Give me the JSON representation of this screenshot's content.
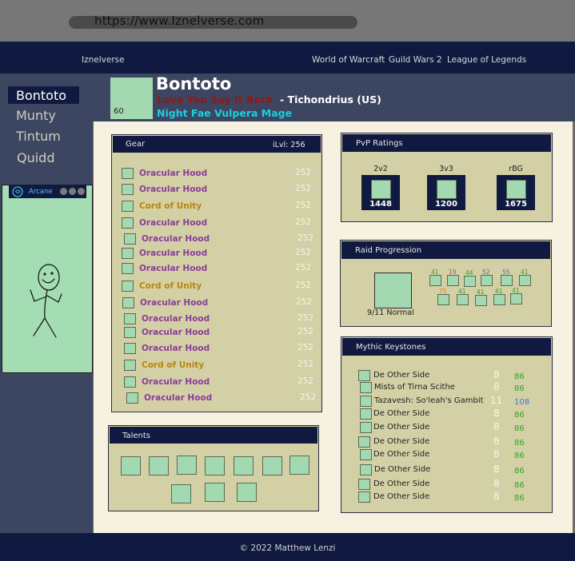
{
  "browser": {
    "url": "https://www.Iznelverse.com"
  },
  "nav": {
    "brand": "Iznelverse",
    "links": [
      "World of Warcraft",
      "Guild Wars 2",
      "League of Legends"
    ]
  },
  "sidebar": {
    "characters": [
      "Bontoto",
      "Munty",
      "Tintum",
      "Quidd"
    ],
    "spec": {
      "label": "Arcane"
    }
  },
  "character": {
    "name": "Bontoto",
    "guild": "Love You Say It Back",
    "realm": "- Tichondrius (US)",
    "race_class": "Night Fae Vulpera Mage",
    "portrait_level": "60"
  },
  "gear": {
    "title": "Gear",
    "ilvl": "iLvl: 256",
    "items": [
      {
        "name": "Oracular Hood",
        "lvl": "252",
        "color": "#8a3d9a"
      },
      {
        "name": "Oracular Hood",
        "lvl": "252",
        "color": "#8a3d9a"
      },
      {
        "name": "Cord of Unity",
        "lvl": "252",
        "color": "#b8860b"
      },
      {
        "name": "Oracular Hood",
        "lvl": "252",
        "color": "#8a3d9a"
      },
      {
        "name": "Oracular Hood",
        "lvl": "252",
        "color": "#8a3d9a"
      },
      {
        "name": "Oracular Hood",
        "lvl": "252",
        "color": "#8a3d9a"
      },
      {
        "name": "Oracular Hood",
        "lvl": "252",
        "color": "#8a3d9a"
      },
      {
        "name": "Cord of Unity",
        "lvl": "252",
        "color": "#b8860b"
      },
      {
        "name": "Oracular Hood",
        "lvl": "252",
        "color": "#8a3d9a"
      },
      {
        "name": "Oracular Hood",
        "lvl": "252",
        "color": "#8a3d9a"
      },
      {
        "name": "Oracular Hood",
        "lvl": "252",
        "color": "#8a3d9a"
      },
      {
        "name": "Oracular Hood",
        "lvl": "252",
        "color": "#8a3d9a"
      },
      {
        "name": "Cord of Unity",
        "lvl": "252",
        "color": "#b8860b"
      },
      {
        "name": "Oracular Hood",
        "lvl": "252",
        "color": "#8a3d9a"
      },
      {
        "name": "Oracular Hood",
        "lvl": "252",
        "color": "#8a3d9a"
      }
    ]
  },
  "talents": {
    "title": "Talents"
  },
  "pvp": {
    "title": "PvP Ratings",
    "ratings": [
      {
        "label": "2v2",
        "value": "1448"
      },
      {
        "label": "3v3",
        "value": "1200"
      },
      {
        "label": "rBG",
        "value": "1675"
      }
    ]
  },
  "raid": {
    "title": "Raid Progression",
    "summary": "9/11 Normal",
    "bosses": [
      {
        "value": "41",
        "color": "#2e9e2e"
      },
      {
        "value": "19",
        "color": "#b5547a"
      },
      {
        "value": "44",
        "color": "#2e9e2e"
      },
      {
        "value": "52",
        "color": "#3d6ad0"
      },
      {
        "value": "55",
        "color": "#3d6ad0"
      },
      {
        "value": "41",
        "color": "#2e9e2e"
      },
      {
        "value": "75",
        "color": "#d4881e"
      },
      {
        "value": "41",
        "color": "#2e9e2e"
      },
      {
        "value": "41",
        "color": "#2e9e2e"
      },
      {
        "value": "41",
        "color": "#2e9e2e"
      },
      {
        "value": "41",
        "color": "#2e9e2e"
      }
    ]
  },
  "mythic": {
    "title": "Mythic Keystones",
    "runs": [
      {
        "dungeon": "De Other Side",
        "level": "8",
        "score": "86",
        "color": "#2aa82a"
      },
      {
        "dungeon": "Mists of Tirna Scithe",
        "level": "8",
        "score": "86",
        "color": "#2aa82a"
      },
      {
        "dungeon": "Tazavesh: So'leah's Gambit",
        "level": "11",
        "score": "108",
        "color": "#3d7ad8"
      },
      {
        "dungeon": "De Other Side",
        "level": "8",
        "score": "86",
        "color": "#2aa82a"
      },
      {
        "dungeon": "De Other Side",
        "level": "8",
        "score": "86",
        "color": "#2aa82a"
      },
      {
        "dungeon": "De Other Side",
        "level": "8",
        "score": "86",
        "color": "#2aa82a"
      },
      {
        "dungeon": "De Other Side",
        "level": "8",
        "score": "86",
        "color": "#2aa82a"
      },
      {
        "dungeon": "De Other Side",
        "level": "8",
        "score": "86",
        "color": "#2aa82a"
      },
      {
        "dungeon": "De Other Side",
        "level": "8",
        "score": "86",
        "color": "#2aa82a"
      },
      {
        "dungeon": "De Other Side",
        "level": "8",
        "score": "86",
        "color": "#2aa82a"
      }
    ]
  },
  "footer": {
    "text": "© 2022 Matthew Lenzi"
  }
}
